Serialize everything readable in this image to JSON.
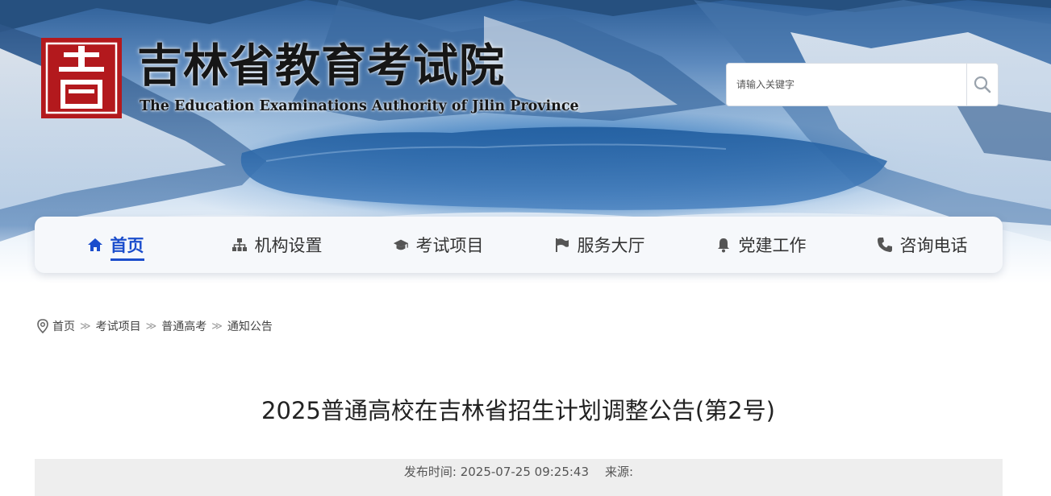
{
  "header": {
    "seal_char": "吉",
    "title": "吉林省教育考试院",
    "subtitle": "The Education Examinations Authority of Jilin Province"
  },
  "search": {
    "placeholder": "请输入关键字",
    "icon": "search-icon"
  },
  "nav": {
    "items": [
      {
        "label": "首页",
        "icon": "home-icon",
        "active": true
      },
      {
        "label": "机构设置",
        "icon": "sitemap-icon",
        "active": false
      },
      {
        "label": "考试项目",
        "icon": "graduation-cap-icon",
        "active": false
      },
      {
        "label": "服务大厅",
        "icon": "flag-icon",
        "active": false
      },
      {
        "label": "党建工作",
        "icon": "bell-icon",
        "active": false
      },
      {
        "label": "咨询电话",
        "icon": "phone-icon",
        "active": false
      }
    ]
  },
  "breadcrumb": {
    "icon": "location-pin-icon",
    "items": [
      "首页",
      "考试项目",
      "普通高考",
      "通知公告"
    ],
    "separator": "≫"
  },
  "article": {
    "title": "2025普通高校在吉林省招生计划调整公告(第2号)",
    "publish_label": "发布时间: 2025-07-25 09:25:43",
    "source_label": "来源:"
  },
  "colors": {
    "accent": "#1b4dcc",
    "seal_red": "#b3191d",
    "meta_bg": "#eeeeee"
  }
}
